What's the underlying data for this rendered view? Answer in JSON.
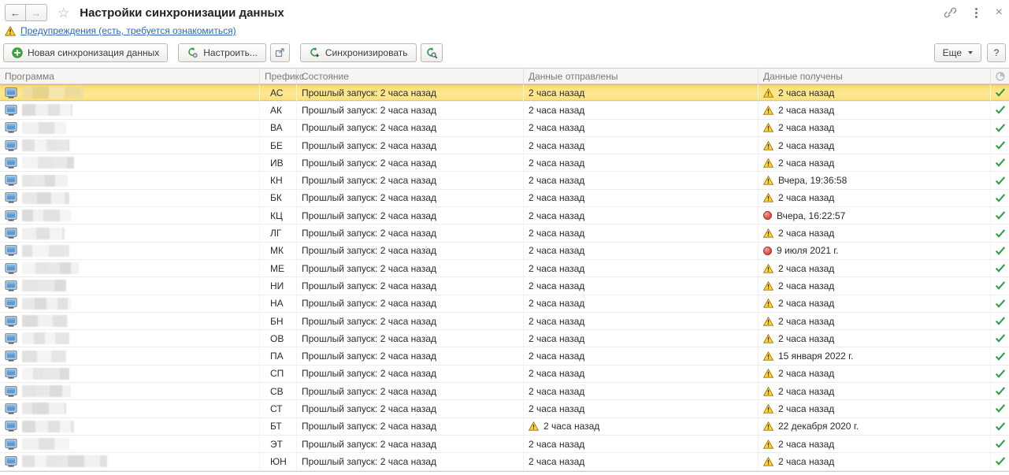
{
  "titlebar": {
    "title": "Настройки синхронизации данных",
    "icons": {
      "back": "←",
      "forward": "→",
      "favorite": "☆",
      "close": "×"
    }
  },
  "warning_banner": {
    "text": "Предупреждения (есть, требуется ознакомиться)",
    "icon": "warning-triangle"
  },
  "toolbar": {
    "new_sync_label": "Новая синхронизация данных",
    "configure_label": "Настроить...",
    "synchronize_label": "Синхронизировать",
    "more_label": "Еще",
    "help_label": "?"
  },
  "table": {
    "program_names_redacted": true,
    "columns": [
      {
        "label": "Программа"
      },
      {
        "label": "Префикс"
      },
      {
        "label": "Состояние"
      },
      {
        "label": "Данные отправлены"
      },
      {
        "label": "Данные получены"
      },
      {
        "label": "",
        "icon": "pie-chart-icon"
      }
    ],
    "rows": [
      {
        "prefix": "АС",
        "state": "Прошлый запуск: 2 часа назад",
        "sent": "2 часа назад",
        "sent_icon": "none",
        "received": "2 часа назад",
        "received_icon": "warning",
        "result_icon": "check",
        "selected": true
      },
      {
        "prefix": "АК",
        "state": "Прошлый запуск: 2 часа назад",
        "sent": "2 часа назад",
        "sent_icon": "none",
        "received": "2 часа назад",
        "received_icon": "warning",
        "result_icon": "check",
        "selected": false
      },
      {
        "prefix": "ВА",
        "state": "Прошлый запуск: 2 часа назад",
        "sent": "2 часа назад",
        "sent_icon": "none",
        "received": "2 часа назад",
        "received_icon": "warning",
        "result_icon": "check",
        "selected": false
      },
      {
        "prefix": "БЕ",
        "state": "Прошлый запуск: 2 часа назад",
        "sent": "2 часа назад",
        "sent_icon": "none",
        "received": "2 часа назад",
        "received_icon": "warning",
        "result_icon": "check",
        "selected": false
      },
      {
        "prefix": "ИВ",
        "state": "Прошлый запуск: 2 часа назад",
        "sent": "2 часа назад",
        "sent_icon": "none",
        "received": "2 часа назад",
        "received_icon": "warning",
        "result_icon": "check",
        "selected": false
      },
      {
        "prefix": "КН",
        "state": "Прошлый запуск: 2 часа назад",
        "sent": "2 часа назад",
        "sent_icon": "none",
        "received": "Вчера, 19:36:58",
        "received_icon": "warning",
        "result_icon": "check",
        "selected": false
      },
      {
        "prefix": "БК",
        "state": "Прошлый запуск: 2 часа назад",
        "sent": "2 часа назад",
        "sent_icon": "none",
        "received": "2 часа назад",
        "received_icon": "warning",
        "result_icon": "check",
        "selected": false
      },
      {
        "prefix": "КЦ",
        "state": "Прошлый запуск: 2 часа назад",
        "sent": "2 часа назад",
        "sent_icon": "none",
        "received": "Вчера, 16:22:57",
        "received_icon": "error",
        "result_icon": "check",
        "selected": false
      },
      {
        "prefix": "ЛГ",
        "state": "Прошлый запуск: 2 часа назад",
        "sent": "2 часа назад",
        "sent_icon": "none",
        "received": "2 часа назад",
        "received_icon": "warning",
        "result_icon": "check",
        "selected": false
      },
      {
        "prefix": "МК",
        "state": "Прошлый запуск: 2 часа назад",
        "sent": "2 часа назад",
        "sent_icon": "none",
        "received": "9 июля 2021 г.",
        "received_icon": "error",
        "result_icon": "check",
        "selected": false
      },
      {
        "prefix": "МЕ",
        "state": "Прошлый запуск: 2 часа назад",
        "sent": "2 часа назад",
        "sent_icon": "none",
        "received": "2 часа назад",
        "received_icon": "warning",
        "result_icon": "check",
        "selected": false
      },
      {
        "prefix": "НИ",
        "state": "Прошлый запуск: 2 часа назад",
        "sent": "2 часа назад",
        "sent_icon": "none",
        "received": "2 часа назад",
        "received_icon": "warning",
        "result_icon": "check",
        "selected": false
      },
      {
        "prefix": "НА",
        "state": "Прошлый запуск: 2 часа назад",
        "sent": "2 часа назад",
        "sent_icon": "none",
        "received": "2 часа назад",
        "received_icon": "warning",
        "result_icon": "check",
        "selected": false
      },
      {
        "prefix": "БН",
        "state": "Прошлый запуск: 2 часа назад",
        "sent": "2 часа назад",
        "sent_icon": "none",
        "received": "2 часа назад",
        "received_icon": "warning",
        "result_icon": "check",
        "selected": false
      },
      {
        "prefix": "ОВ",
        "state": "Прошлый запуск: 2 часа назад",
        "sent": "2 часа назад",
        "sent_icon": "none",
        "received": "2 часа назад",
        "received_icon": "warning",
        "result_icon": "check",
        "selected": false
      },
      {
        "prefix": "ПА",
        "state": "Прошлый запуск: 2 часа назад",
        "sent": "2 часа назад",
        "sent_icon": "none",
        "received": "15 января 2022 г.",
        "received_icon": "warning",
        "result_icon": "check",
        "selected": false
      },
      {
        "prefix": "СП",
        "state": "Прошлый запуск: 2 часа назад",
        "sent": "2 часа назад",
        "sent_icon": "none",
        "received": "2 часа назад",
        "received_icon": "warning",
        "result_icon": "check",
        "selected": false
      },
      {
        "prefix": "СВ",
        "state": "Прошлый запуск: 2 часа назад",
        "sent": "2 часа назад",
        "sent_icon": "none",
        "received": "2 часа назад",
        "received_icon": "warning",
        "result_icon": "check",
        "selected": false
      },
      {
        "prefix": "СТ",
        "state": "Прошлый запуск: 2 часа назад",
        "sent": "2 часа назад",
        "sent_icon": "none",
        "received": "2 часа назад",
        "received_icon": "warning",
        "result_icon": "check",
        "selected": false
      },
      {
        "prefix": "БТ",
        "state": "Прошлый запуск: 2 часа назад",
        "sent": "2 часа назад",
        "sent_icon": "warning",
        "received": "22 декабря 2020 г.",
        "received_icon": "warning",
        "result_icon": "check",
        "selected": false
      },
      {
        "prefix": "ЭТ",
        "state": "Прошлый запуск: 2 часа назад",
        "sent": "2 часа назад",
        "sent_icon": "none",
        "received": "2 часа назад",
        "received_icon": "warning",
        "result_icon": "check",
        "selected": false
      },
      {
        "prefix": "ЮН",
        "state": "Прошлый запуск: 2 часа назад",
        "sent": "2 часа назад",
        "sent_icon": "none",
        "received": "2 часа назад",
        "received_icon": "warning",
        "result_icon": "check",
        "selected": false
      }
    ]
  },
  "colors": {
    "selected_row": "#FBE283",
    "warning_yellow": "#F6C42F",
    "error_red": "#D8453C",
    "success_green": "#2E9E44",
    "link_blue": "#3067BA",
    "header_text": "#7A7A7A"
  }
}
